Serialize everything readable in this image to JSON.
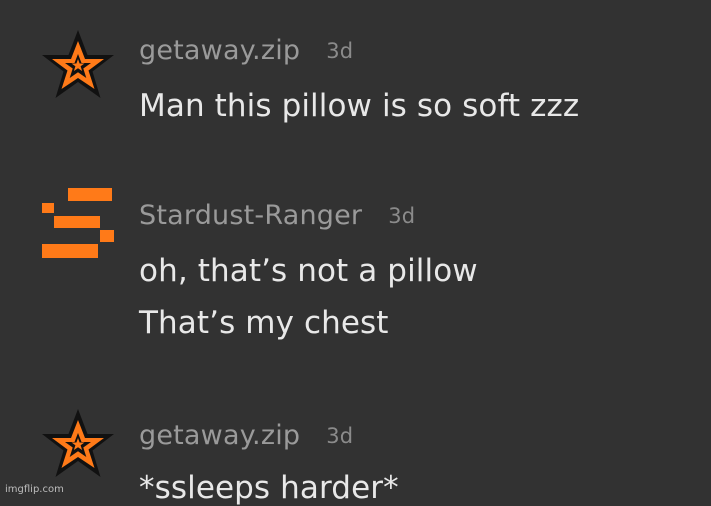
{
  "comments": [
    {
      "avatar_icon": "orange-star-icon",
      "username": "getaway.zip",
      "timestamp": "3d",
      "lines": [
        "Man this pillow is so soft zzz"
      ]
    },
    {
      "avatar_icon": "orange-s-block-icon",
      "username": "Stardust-Ranger",
      "timestamp": "3d",
      "lines": [
        "oh, that’s not a pillow",
        "That’s my chest"
      ]
    },
    {
      "avatar_icon": "orange-star-icon",
      "username": "getaway.zip",
      "timestamp": "3d",
      "lines": [
        "*ssleeps harder*"
      ]
    }
  ],
  "watermark": "imgflip.com",
  "colors": {
    "background": "#323232",
    "username": "#9a9a9a",
    "text": "#e8e8e8",
    "accent": "#ff7a18"
  }
}
